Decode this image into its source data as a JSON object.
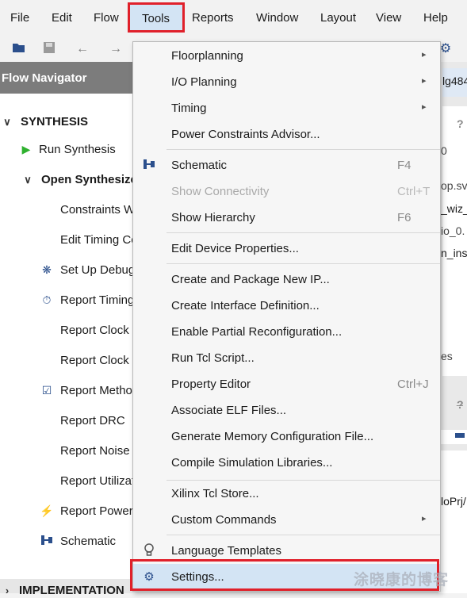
{
  "menubar": {
    "items": [
      "File",
      "Edit",
      "Flow",
      "Tools",
      "Reports",
      "Window",
      "Layout",
      "View",
      "Help"
    ]
  },
  "toolbar": {
    "icons": [
      "open-project-icon",
      "save-icon",
      "undo-icon",
      "redo-icon",
      "gear-icon"
    ]
  },
  "flow_navigator": {
    "title": "Flow Navigator",
    "synthesis_label": "SYNTHESIS",
    "run_synthesis": "Run Synthesis",
    "open_synthesized": "Open Synthesize",
    "items": [
      "Constraints W",
      "Edit Timing Co",
      "Set Up Debug",
      "Report Timing",
      "Report Clock I",
      "Report Clock I",
      "Report Metho",
      "Report DRC",
      "Report Noise",
      "Report Utilizat",
      "Report Power",
      "Schematic"
    ],
    "implementation_label": "IMPLEMENTATION"
  },
  "right_panel": {
    "texts": [
      "lg484",
      "?",
      "0",
      "op.sv",
      "_wiz_",
      "io_0.",
      "n_inst",
      "es",
      "?",
      "_",
      "loPrj/"
    ]
  },
  "tools_menu": {
    "items": [
      {
        "label": "Floorplanning",
        "submenu": "▸"
      },
      {
        "label": "I/O Planning",
        "submenu": "▸"
      },
      {
        "label": "Timing",
        "submenu": "▸"
      },
      {
        "label": "Power Constraints Advisor..."
      },
      {
        "label": "Schematic",
        "shortcut": "F4"
      },
      {
        "label": "Show Connectivity",
        "shortcut": "Ctrl+T"
      },
      {
        "label": "Show Hierarchy",
        "shortcut": "F6"
      },
      {
        "label": "Edit Device Properties..."
      },
      {
        "label": "Create and Package New IP..."
      },
      {
        "label": "Create Interface Definition..."
      },
      {
        "label": "Enable Partial Reconfiguration..."
      },
      {
        "label": "Run Tcl Script..."
      },
      {
        "label": "Property Editor",
        "shortcut": "Ctrl+J"
      },
      {
        "label": "Associate ELF Files..."
      },
      {
        "label": "Generate Memory Configuration File..."
      },
      {
        "label": "Compile Simulation Libraries..."
      },
      {
        "label": "Xilinx Tcl Store..."
      },
      {
        "label": "Custom Commands",
        "submenu": "▸"
      },
      {
        "label": "Language Templates"
      },
      {
        "label": "Settings..."
      }
    ]
  },
  "watermark": "涂晓康的博客",
  "colors": {
    "highlight_border": "#e0202a",
    "selected_bg": "#d3e4f4",
    "header_bg": "#7c7c7c",
    "play_green": "#2fb12f"
  }
}
